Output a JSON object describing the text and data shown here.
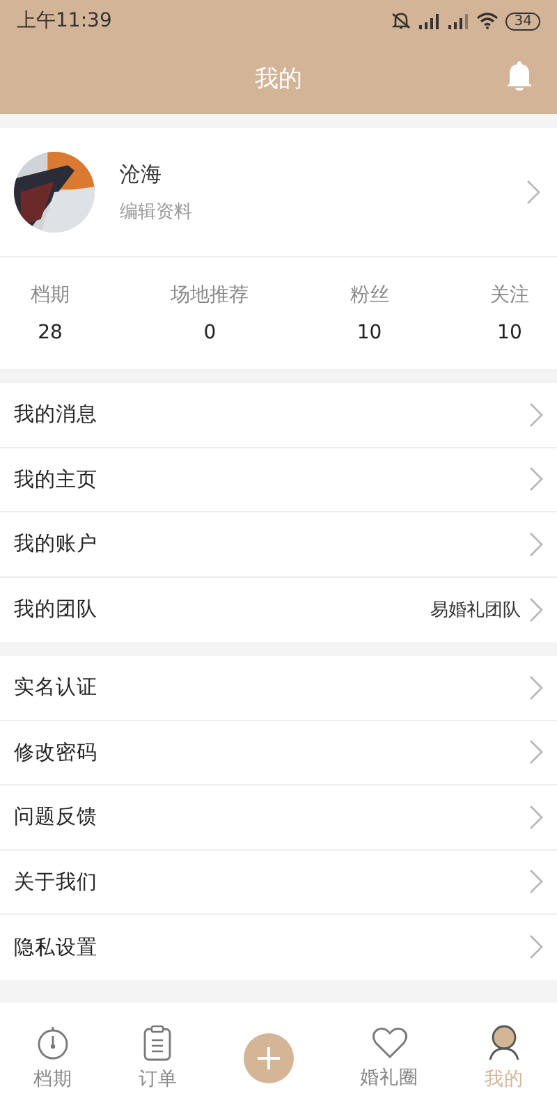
{
  "status_bar": {
    "time": "上午11:39",
    "battery": "34"
  },
  "header": {
    "title": "我的"
  },
  "profile": {
    "name": "沧海",
    "subtitle": "编辑资料"
  },
  "stats": [
    {
      "label": "档期",
      "value": "28"
    },
    {
      "label": "场地推荐",
      "value": "0"
    },
    {
      "label": "粉丝",
      "value": "10"
    },
    {
      "label": "关注",
      "value": "10"
    }
  ],
  "menu_groups": [
    [
      {
        "label": "我的消息"
      },
      {
        "label": "我的主页"
      },
      {
        "label": "我的账户"
      },
      {
        "label": "我的团队",
        "value": "易婚礼团队"
      }
    ],
    [
      {
        "label": "实名认证"
      },
      {
        "label": "修改密码"
      },
      {
        "label": "问题反馈"
      },
      {
        "label": "关于我们"
      },
      {
        "label": "隐私设置"
      }
    ]
  ],
  "tab_bar": [
    {
      "label": "档期",
      "kind": "clock",
      "selected": false
    },
    {
      "label": "订单",
      "kind": "clipboard",
      "selected": false
    },
    {
      "kind": "add"
    },
    {
      "label": "婚礼圈",
      "kind": "heart",
      "selected": false
    },
    {
      "label": "我的",
      "kind": "user",
      "selected": true
    }
  ]
}
